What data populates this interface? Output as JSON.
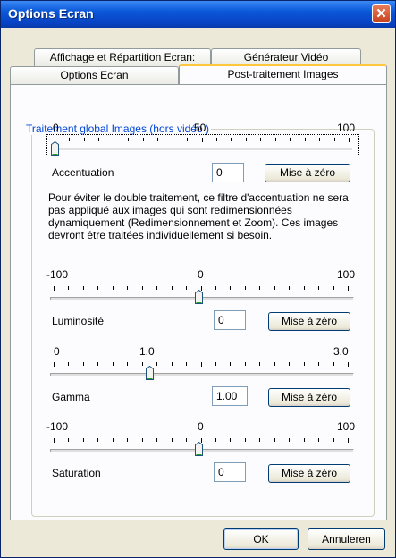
{
  "window": {
    "title": "Options Ecran",
    "close_glyph": "✕"
  },
  "tabs": {
    "row_top": [
      "Affichage et Répartition Ecran:",
      "Générateur Vidéo"
    ],
    "row_bottom": [
      "Options Ecran",
      "Post-traitement Images"
    ],
    "active": "Post-traitement Images"
  },
  "group": {
    "title": "Traitement global Images (hors vidéo )"
  },
  "accentuation": {
    "scale": {
      "min": "0",
      "mid": "50",
      "max": "100"
    },
    "value": 0,
    "label": "Accentuation",
    "input": "0",
    "reset_label": "Mise à zéro"
  },
  "note": "Pour éviter le double traitement, ce filtre d'accentuation ne sera pas appliqué aux images qui sont redimensionnées dynamiquement (Redimensionnement et Zoom). Ces images devront être traitées individuellement si besoin.",
  "luminosite": {
    "scale": {
      "min": "-100",
      "mid": "0",
      "max": "100"
    },
    "value": 0,
    "label": "Luminosité",
    "input": "0",
    "reset_label": "Mise à zéro"
  },
  "gamma": {
    "scale": {
      "min": "0",
      "mid": "1.0",
      "max": "3.0"
    },
    "value": 1.0,
    "label": "Gamma",
    "input": "1.00",
    "reset_label": "Mise à zéro"
  },
  "saturation": {
    "scale": {
      "min": "-100",
      "mid": "0",
      "max": "100"
    },
    "value": 0,
    "label": "Saturation",
    "input": "0",
    "reset_label": "Mise à zéro"
  },
  "footer": {
    "ok_label": "OK",
    "cancel_label": "Annuleren"
  }
}
